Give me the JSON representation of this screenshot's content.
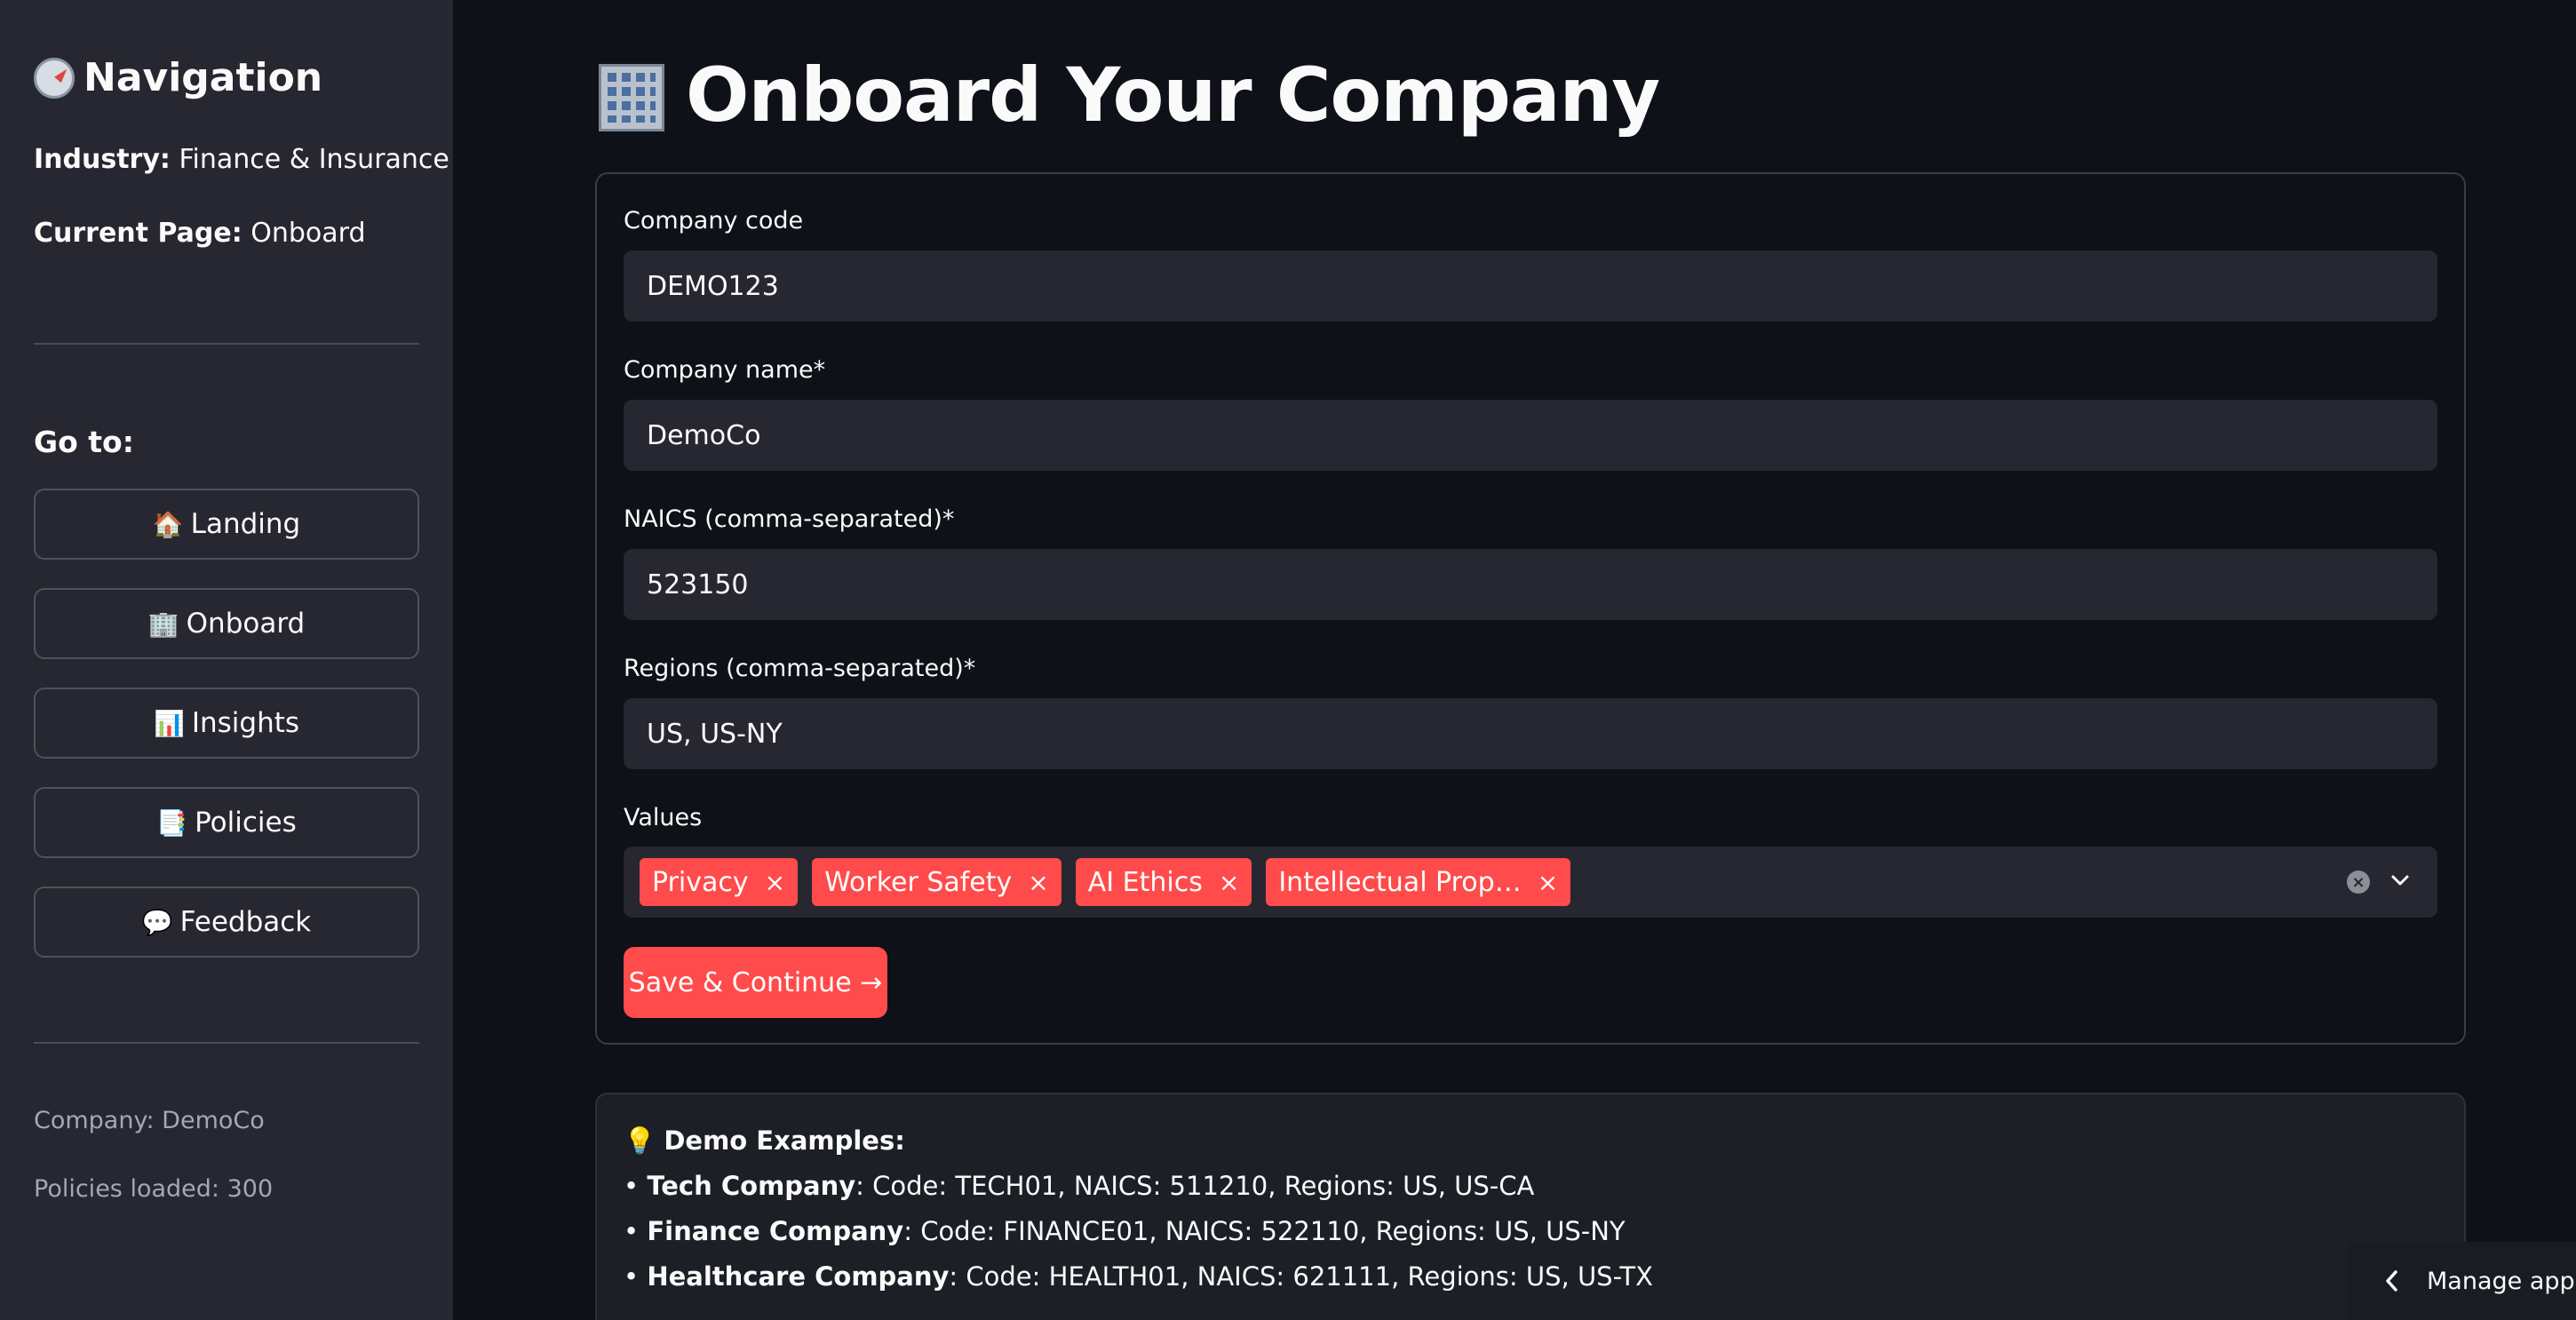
{
  "sidebar": {
    "title": "Navigation",
    "industry_label": "Industry:",
    "industry_value": "Finance & Insurance",
    "current_page_label": "Current Page:",
    "current_page_value": "Onboard",
    "goto_label": "Go to:",
    "nav_items": [
      {
        "emoji": "🏠",
        "label": "Landing"
      },
      {
        "emoji": "🏢",
        "label": "Onboard"
      },
      {
        "emoji": "📊",
        "label": "Insights"
      },
      {
        "emoji": "📑",
        "label": "Policies"
      },
      {
        "emoji": "💬",
        "label": "Feedback"
      }
    ],
    "company_status": "Company: DemoCo",
    "policies_status": "Policies loaded: 300"
  },
  "main": {
    "title": "Onboard Your Company",
    "form": {
      "company_code_label": "Company code",
      "company_code_value": "DEMO123",
      "company_name_label": "Company name*",
      "company_name_value": "DemoCo",
      "naics_label": "NAICS (comma-separated)*",
      "naics_value": "523150",
      "regions_label": "Regions (comma-separated)*",
      "regions_value": "US, US-NY",
      "values_label": "Values",
      "values_tags": [
        "Privacy",
        "Worker Safety",
        "AI Ethics",
        "Intellectual Prop…"
      ],
      "tag_remove_glyph": "×",
      "clear_glyph": "×",
      "save_label": "Save & Continue →"
    },
    "demo": {
      "emoji": "💡",
      "heading": "Demo Examples:",
      "bullet": "•",
      "examples": [
        {
          "name": "Tech Company",
          "details": ": Code: TECH01, NAICS: 511210, Regions: US, US-CA"
        },
        {
          "name": "Finance Company",
          "details": ": Code: FINANCE01, NAICS: 522110, Regions: US, US-NY"
        },
        {
          "name": "Healthcare Company",
          "details": ": Code: HEALTH01, NAICS: 621111, Regions: US, US-TX"
        }
      ]
    }
  },
  "footer": {
    "manage_app_label": "Manage app"
  },
  "colors": {
    "background": "#0e1117",
    "sidebar": "#262730",
    "accent": "#ff4b4b",
    "input": "#262730"
  }
}
